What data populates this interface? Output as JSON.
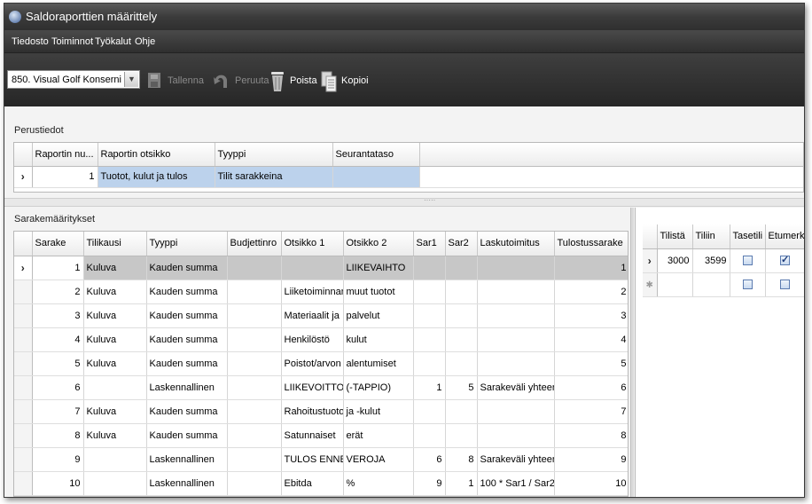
{
  "window": {
    "title": "Saldoraporttien määrittely"
  },
  "menu": [
    "Tiedosto",
    "Toiminnot",
    "Työkalut",
    "Ohje"
  ],
  "toolbar": {
    "company_combo": "850. Visual Golf Konserni",
    "save_label": "Tallenna",
    "undo_label": "Peruuta",
    "delete_label": "Poista",
    "copy_label": "Kopioi"
  },
  "perustiedot": {
    "label": "Perustiedot",
    "columns": [
      "Raportin nu...",
      "Raportin otsikko",
      "Tyyppi",
      "Seurantataso"
    ],
    "row": {
      "number": "1",
      "title": "Tuotot, kulut ja tulos",
      "type": "Tilit sarakkeina",
      "level": ""
    }
  },
  "sarakemaaritykset": {
    "label": "Sarakemääritykset",
    "columns": [
      "Sarake",
      "Tilikausi",
      "Tyyppi",
      "Budjettinro",
      "Otsikko 1",
      "Otsikko 2",
      "Sar1",
      "Sar2",
      "Laskutoimitus",
      "Tulostussarake"
    ],
    "rows": [
      [
        "1",
        "Kuluva",
        "Kauden summa",
        "",
        "",
        "LIIKEVAIHTO",
        "",
        "",
        "",
        "1"
      ],
      [
        "2",
        "Kuluva",
        "Kauden summa",
        "",
        "Liiketoiminnan",
        "muut tuotot",
        "",
        "",
        "",
        "2"
      ],
      [
        "3",
        "Kuluva",
        "Kauden summa",
        "",
        "Materiaalit ja",
        "palvelut",
        "",
        "",
        "",
        "3"
      ],
      [
        "4",
        "Kuluva",
        "Kauden summa",
        "",
        "Henkilöstö",
        "kulut",
        "",
        "",
        "",
        "4"
      ],
      [
        "5",
        "Kuluva",
        "Kauden summa",
        "",
        "Poistot/arvon",
        "alentumiset",
        "",
        "",
        "",
        "5"
      ],
      [
        "6",
        "",
        "Laskennallinen",
        "",
        "LIIKEVOITTO",
        "(-TAPPIO)",
        "1",
        "5",
        "Sarakeväli yhteensä",
        "6"
      ],
      [
        "7",
        "Kuluva",
        "Kauden summa",
        "",
        "Rahoitustuotot",
        "ja -kulut",
        "",
        "",
        "",
        "7"
      ],
      [
        "8",
        "Kuluva",
        "Kauden summa",
        "",
        "Satunnaiset",
        "erät",
        "",
        "",
        "",
        "8"
      ],
      [
        "9",
        "",
        "Laskennallinen",
        "",
        "TULOS ENNEN",
        "VEROJA",
        "6",
        "8",
        "Sarakeväli yhteensä",
        "9"
      ],
      [
        "10",
        "",
        "Laskennallinen",
        "",
        "Ebitda",
        "%",
        "9",
        "1",
        "100 * Sar1 / Sar2",
        "10"
      ]
    ]
  },
  "accounts": {
    "columns": [
      "Tilistä",
      "Tiliin",
      "Tasetili",
      "Etumerkin ..."
    ],
    "rows": [
      {
        "from": "3000",
        "to": "3599",
        "balance_checked": false,
        "sign_checked": true
      }
    ]
  }
}
